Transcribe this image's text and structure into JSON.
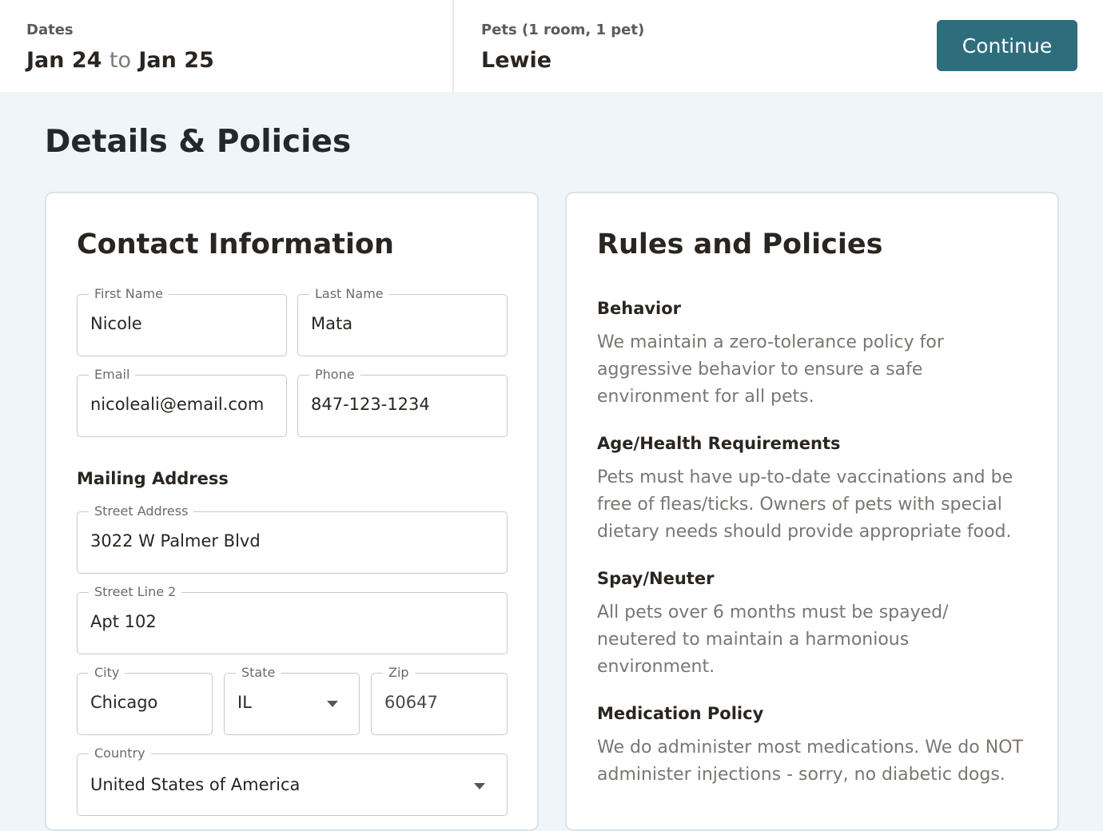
{
  "header": {
    "dates_label": "Dates",
    "date_from": "Jan 24",
    "date_to_word": "to",
    "date_to": "Jan 25",
    "pets_label": "Pets (1 room, 1 pet)",
    "pets_value": "Lewie",
    "continue_label": "Continue"
  },
  "page_title": "Details & Policies",
  "contact": {
    "title": "Contact Information",
    "first_name": {
      "label": "First Name",
      "value": "Nicole"
    },
    "last_name": {
      "label": "Last Name",
      "value": "Mata"
    },
    "email": {
      "label": "Email",
      "value": "nicoleali@email.com"
    },
    "phone": {
      "label": "Phone",
      "value": "847-123-1234"
    },
    "mailing_heading": "Mailing Address",
    "street": {
      "label": "Street Address",
      "value": "3022 W Palmer Blvd"
    },
    "street2": {
      "label": "Street Line 2",
      "value": "Apt 102"
    },
    "city": {
      "label": "City",
      "value": "Chicago"
    },
    "state": {
      "label": "State",
      "value": "IL"
    },
    "zip": {
      "label": "Zip",
      "value": "60647"
    },
    "country": {
      "label": "Country",
      "value": "United States of America"
    }
  },
  "policies": {
    "title": "Rules and Policies",
    "items": [
      {
        "heading": "Behavior",
        "text": "We maintain a zero-tolerance policy for aggressive behavior to ensure a safe environment for all pets."
      },
      {
        "heading": "Age/Health Requirements",
        "text": "Pets must have up-to-date vaccinations and be free of fleas/ticks. Owners of pets with special dietary needs should provide appropriate food."
      },
      {
        "heading": "Spay/Neuter",
        "text": "All pets over 6 months must be spayed/ neutered to maintain a harmonious environment."
      },
      {
        "heading": "Medication Policy",
        "text": "We do administer most medications. We do NOT administer injections - sorry, no diabetic dogs."
      }
    ]
  },
  "colors": {
    "accent": "#2e6d7c",
    "background": "#f0f5f9",
    "text": "#2a2520",
    "muted_text": "#7a7672"
  }
}
